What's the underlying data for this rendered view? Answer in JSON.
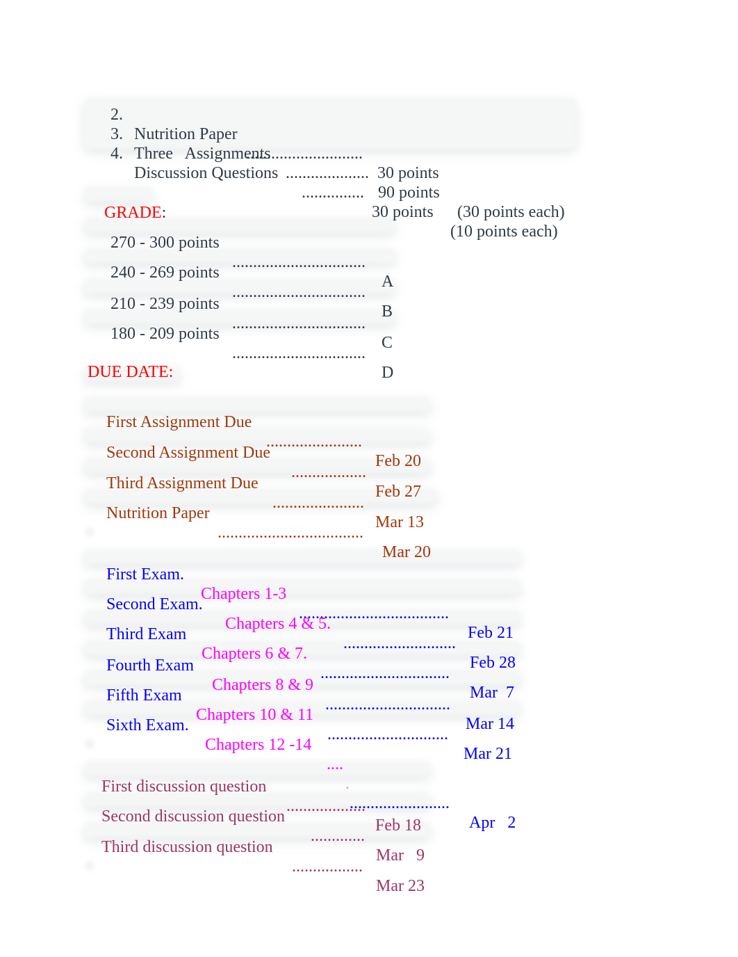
{
  "points_list": [
    {
      "number": "2.",
      "label": "Nutrition Paper",
      "leader": "............................",
      "points": "30 points",
      "note": ""
    },
    {
      "number": "3.",
      "label": "Three   Assignments",
      "leader": "....................",
      "points": "90 points",
      "note": "(30 points each)"
    },
    {
      "number": "4.",
      "label": "Discussion Questions",
      "leader": "...............",
      "points": "30 points",
      "note": "(10 points each)"
    }
  ],
  "grade": {
    "heading": "GRADE",
    "heading_suffix": ":",
    "rows": [
      {
        "range": "270 - 300 points",
        "leader": "................................",
        "letter": "A"
      },
      {
        "range": "240 - 269 points",
        "leader": "................................",
        "letter": "B"
      },
      {
        "range": "210 - 239 points",
        "leader": "................................",
        "letter": "C"
      },
      {
        "range": "180 - 209 points",
        "leader": "................................",
        "letter": "D"
      }
    ]
  },
  "due_date": {
    "heading": "DUE DATE:",
    "assignments": [
      {
        "label": "First Assignment Due",
        "leader": ".......................",
        "date": "Feb 20"
      },
      {
        "label": "Second Assignment Due",
        "leader": "..................",
        "date": "Feb 27"
      },
      {
        "label": "Third Assignment Due",
        "leader": "......................",
        "date": "Mar 13"
      },
      {
        "label": "Nutrition Paper",
        "leader": "...................................",
        "date": "Mar 20"
      }
    ],
    "exams": [
      {
        "label": "First Exam.",
        "chapters": "Chapters 1-3",
        "leader": "....................................",
        "date": "Feb 21"
      },
      {
        "label": "Second Exam.",
        "chapters": "Chapters 4 & 5.",
        "leader": "...........................",
        "date": "Feb 28"
      },
      {
        "label": "Third Exam",
        "chapters": "Chapters 6 & 7.",
        "leader": "...............................",
        "date": "Mar  7"
      },
      {
        "label": "Fourth Exam",
        "chapters": "Chapters 8 & 9",
        "leader": "..............................",
        "date": "Mar 14"
      },
      {
        "label": "Fifth Exam",
        "chapters": "Chapters 10 & 11",
        "leader": ".............................",
        "date": "Mar 21"
      },
      {
        "label": "Sixth Exam.",
        "chapters": "Chapters 12 -14",
        "leader_magenta": "....",
        "leader_tan": ".",
        "leader": "........................",
        "date": "Apr   2"
      }
    ],
    "discussions": [
      {
        "label": "First discussion question",
        "leader": "...................",
        "date": "Feb 18"
      },
      {
        "label": "Second discussion question",
        "leader": ".............",
        "date": "Mar   9"
      },
      {
        "label": "Third discussion question",
        "leader": ".................",
        "date": "Mar 23"
      }
    ]
  },
  "colors": {
    "body_text": "#2f3b45",
    "heading": "#ff0000",
    "assignment": "#a0380c",
    "exam": "#0000ff",
    "chapters": "#ff00ff",
    "discussion": "#9b3566"
  }
}
